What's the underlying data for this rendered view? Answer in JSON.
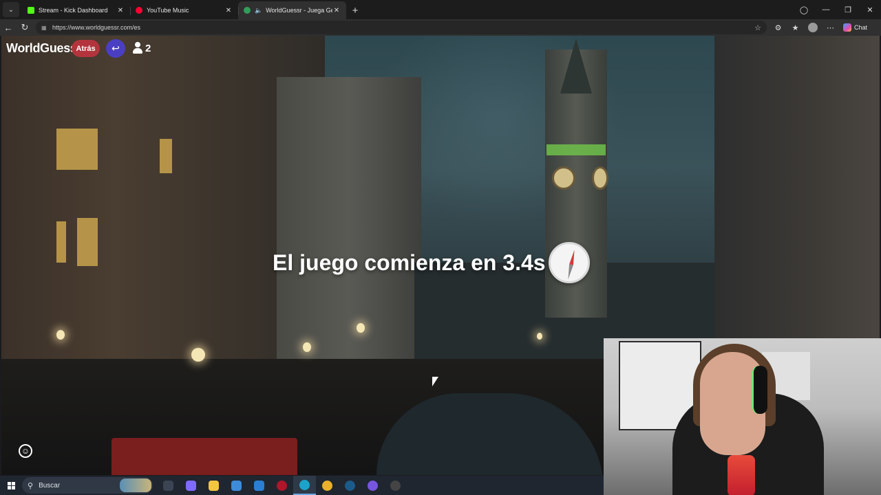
{
  "browser": {
    "tabs_menu_icon": "chevron-down-icon",
    "tabs": [
      {
        "title": "Stream - Kick Dashboard",
        "favicon_color": "#53fc18",
        "active": false
      },
      {
        "title": "YouTube Music",
        "favicon_color": "#ff0033",
        "active": false
      },
      {
        "title": "WorldGuessr - Juega GeoGue",
        "favicon_color": "#2f9e5b",
        "active": true,
        "audio": true
      }
    ],
    "url": "https://www.worldguessr.com/es",
    "chat_label": "Chat"
  },
  "game": {
    "brand": "WorldGuessr",
    "back_label": "Atrás",
    "player_count": "2",
    "countdown_text": "El juego comienza en 3.4s",
    "accent_red": "#b3343d",
    "accent_purple": "#4a3fc2"
  },
  "taskbar": {
    "search_placeholder": "Buscar",
    "apps": [
      {
        "name": "task-view-icon",
        "color": "#3b4452"
      },
      {
        "name": "copilot-icon",
        "color": "#7f6bff"
      },
      {
        "name": "file-explorer-icon",
        "color": "#f3c542"
      },
      {
        "name": "store-icon",
        "color": "#3d8bd9"
      },
      {
        "name": "mail-icon",
        "color": "#2a7fd4"
      },
      {
        "name": "app-red-icon",
        "color": "#b0162a"
      },
      {
        "name": "edge-icon",
        "color": "#1aa4c9"
      },
      {
        "name": "chrome-icon",
        "color": "#e8b12b"
      },
      {
        "name": "steam-icon",
        "color": "#1b5b8a"
      },
      {
        "name": "app-purple-icon",
        "color": "#7656e0"
      },
      {
        "name": "app-dark-icon",
        "color": "#444444"
      }
    ]
  }
}
